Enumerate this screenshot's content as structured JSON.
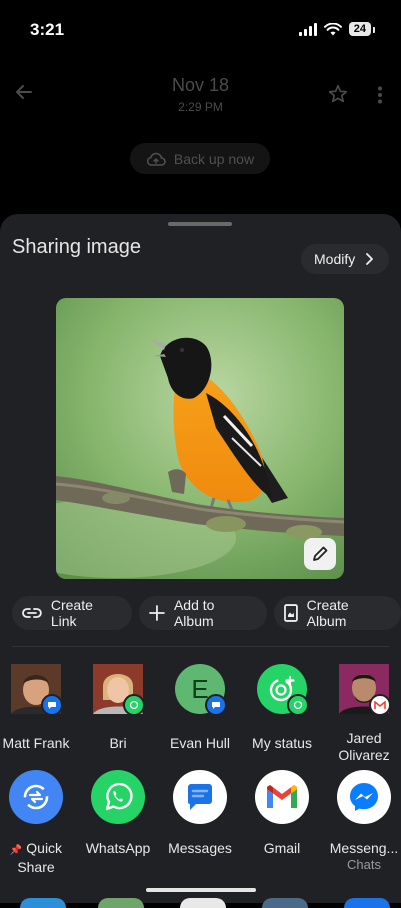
{
  "status": {
    "time": "3:21",
    "battery": "24"
  },
  "photo": {
    "date": "Nov 18",
    "time": "2:29 PM",
    "backup_label": "Back up now"
  },
  "sheet": {
    "title": "Sharing image",
    "modify_label": "Modify",
    "actions": [
      {
        "label": "Create Link",
        "icon": "link-icon"
      },
      {
        "label": "Add to Album",
        "icon": "plus-icon"
      },
      {
        "label": "Create Album",
        "icon": "album-icon"
      }
    ],
    "contacts": [
      {
        "name": "Matt Frank",
        "badge": "messages"
      },
      {
        "name": "Bri",
        "badge": "whatsapp"
      },
      {
        "name": "Evan Hull",
        "initial": "E",
        "badge": "messages"
      },
      {
        "name": "My status",
        "badge": "whatsapp"
      },
      {
        "name": "Jared Olivarez",
        "badge": "gmail"
      }
    ],
    "apps": [
      {
        "name": "Quick Share",
        "icon": "quick-share-icon"
      },
      {
        "name": "WhatsApp",
        "icon": "whatsapp-icon"
      },
      {
        "name": "Messages",
        "icon": "messages-icon"
      },
      {
        "name": "Gmail",
        "icon": "gmail-icon"
      },
      {
        "name": "Messeng...",
        "sub": "Chats",
        "icon": "messenger-icon"
      }
    ]
  },
  "colors": {
    "sheet_bg": "#202124",
    "whatsapp": "#25d366",
    "quick_share": "#4285f4",
    "messages": "#1a73e8",
    "messenger": "#0a7cff"
  }
}
